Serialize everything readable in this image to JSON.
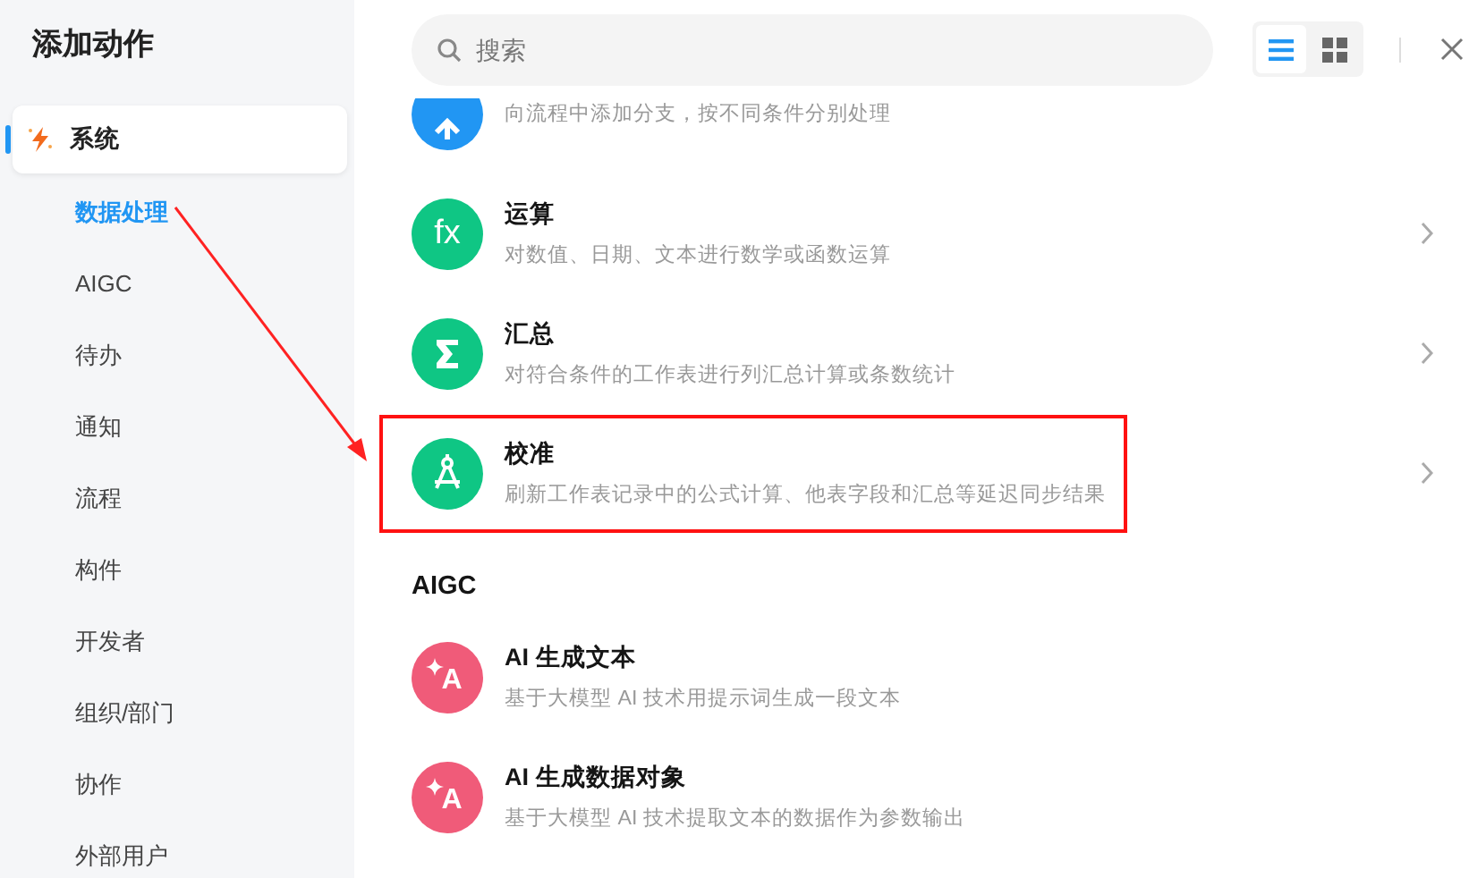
{
  "sidebar": {
    "title": "添加动作",
    "items": [
      {
        "label": "系统",
        "selected": true,
        "children": [
          {
            "label": "数据处理",
            "selected": true
          },
          {
            "label": "AIGC",
            "selected": false
          },
          {
            "label": "待办",
            "selected": false
          },
          {
            "label": "通知",
            "selected": false
          },
          {
            "label": "流程",
            "selected": false
          },
          {
            "label": "构件",
            "selected": false
          },
          {
            "label": "开发者",
            "selected": false
          },
          {
            "label": "组织/部门",
            "selected": false
          },
          {
            "label": "协作",
            "selected": false
          },
          {
            "label": "外部用户",
            "selected": false
          }
        ]
      }
    ]
  },
  "search": {
    "placeholder": "搜索"
  },
  "view_toggle": [
    {
      "kind": "list",
      "selected": true
    },
    {
      "kind": "grid",
      "selected": false
    }
  ],
  "action_groups": [
    {
      "actions": [
        {
          "kind": "branch",
          "color": "#2196f3",
          "description": "向流程中添加分支，按不同条件分别处理",
          "has_arrow": false,
          "highlighted": false
        },
        {
          "kind": "formula",
          "icon_text": "fx",
          "color": "#0fc684",
          "title": "运算",
          "description": "对数值、日期、文本进行数学或函数运算",
          "has_arrow": true,
          "highlighted": false
        },
        {
          "kind": "sum",
          "color": "#0fc684",
          "title": "汇总",
          "description": "对符合条件的工作表进行列汇总计算或条数统计",
          "has_arrow": true,
          "highlighted": false
        },
        {
          "kind": "calibrate",
          "color": "#0fc684",
          "title": "校准",
          "description": "刷新工作表记录中的公式计算、他表字段和汇总等延迟同步结果",
          "has_arrow": true,
          "highlighted": true
        }
      ]
    },
    {
      "heading": "AIGC",
      "actions": [
        {
          "kind": "ai",
          "icon_text": "A",
          "color": "#f05b79",
          "title": "AI 生成文本",
          "description": "基于大模型 AI 技术用提示词生成一段文本",
          "has_arrow": false,
          "highlighted": false
        },
        {
          "kind": "ai",
          "icon_text": "A",
          "color": "#f05b79",
          "title": "AI 生成数据对象",
          "description": "基于大模型 AI 技术提取文本的数据作为参数输出",
          "has_arrow": false,
          "highlighted": false
        }
      ]
    }
  ],
  "annotation_arrow": true
}
